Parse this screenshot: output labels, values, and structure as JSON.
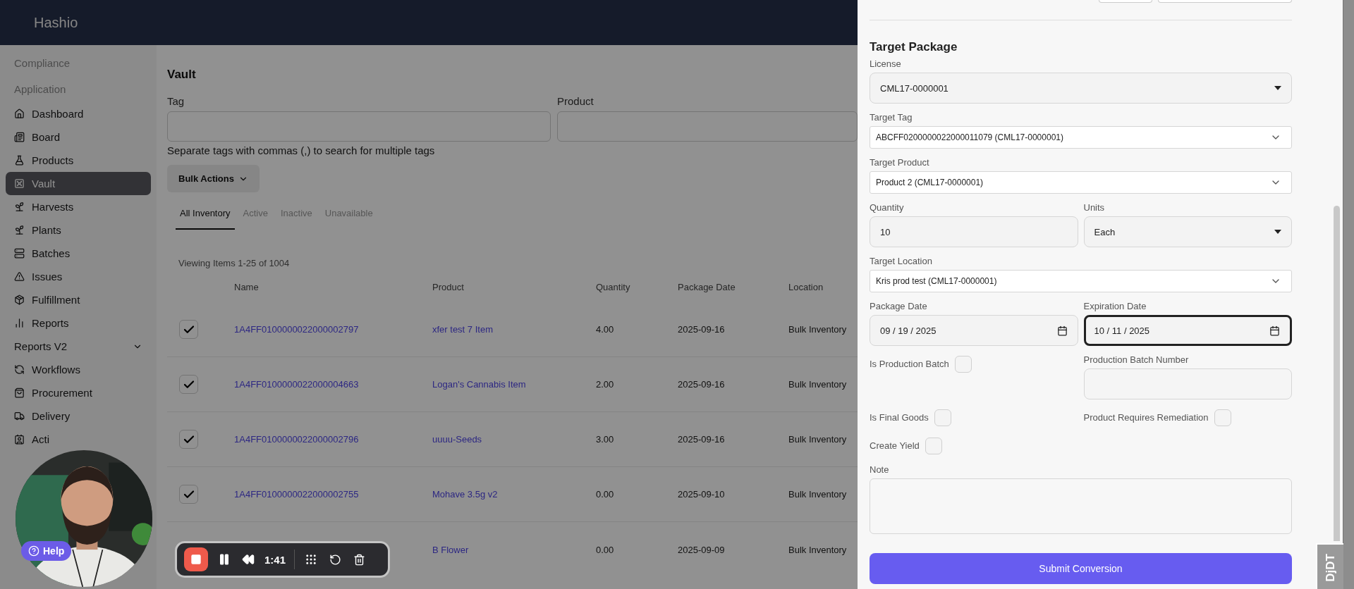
{
  "header": {
    "brand": "Hashio"
  },
  "sidebar": {
    "sections": [
      "Compliance",
      "Application"
    ],
    "items": [
      {
        "label": "Dashboard",
        "kind": "link",
        "selected": false
      },
      {
        "label": "Board",
        "kind": "link",
        "selected": false
      },
      {
        "label": "Products",
        "kind": "link",
        "selected": false
      },
      {
        "label": "Vault",
        "kind": "link",
        "selected": true
      },
      {
        "label": "Harvests",
        "kind": "link",
        "selected": false
      },
      {
        "label": "Plants",
        "kind": "link",
        "selected": false
      },
      {
        "label": "Batches",
        "kind": "link",
        "selected": false
      },
      {
        "label": "Issues",
        "kind": "link",
        "selected": false
      },
      {
        "label": "Fulfillment",
        "kind": "link",
        "selected": false
      },
      {
        "label": "Reports",
        "kind": "link",
        "selected": false
      },
      {
        "label": "Reports V2",
        "kind": "group",
        "expanded": false
      },
      {
        "label": "Workflows",
        "kind": "link",
        "selected": false
      },
      {
        "label": "Procurement",
        "kind": "link",
        "selected": false
      },
      {
        "label": "Delivery",
        "kind": "link",
        "selected": false
      },
      {
        "label": "Acti",
        "kind": "link",
        "selected": false
      }
    ]
  },
  "main": {
    "title": "Vault",
    "filters": [
      {
        "label": "Tag"
      },
      {
        "label": "Product"
      }
    ],
    "filter_hint": "Separate tags with commas (,) to search for multiple tags",
    "bulk_actions": "Bulk Actions",
    "tabs": [
      {
        "label": "All Inventory",
        "selected": true
      },
      {
        "label": "Active",
        "selected": false
      },
      {
        "label": "Inactive",
        "selected": false
      },
      {
        "label": "Unavailable",
        "selected": false
      }
    ],
    "viewing": "Viewing Items 1-25 of 1004",
    "table": {
      "columns": [
        "Name",
        "Product",
        "Quantity",
        "Package Date",
        "Location"
      ],
      "rows": [
        {
          "checked": true,
          "name": "1A4FF0100000022000002797",
          "product": "xfer test 7 Item",
          "quantity": "4.00",
          "package_date": "2025-09-16",
          "location": "Bulk Inventory"
        },
        {
          "checked": true,
          "name": "1A4FF0100000022000004663",
          "product": "Logan's Cannabis Item",
          "quantity": "2.00",
          "package_date": "2025-09-16",
          "location": "Bulk Inventory"
        },
        {
          "checked": true,
          "name": "1A4FF0100000022000002796",
          "product": "uuuu-Seeds",
          "quantity": "3.00",
          "package_date": "2025-09-16",
          "location": "Bulk Inventory"
        },
        {
          "checked": true,
          "name": "1A4FF0100000022000002755",
          "product": "Mohave 3.5g v2",
          "quantity": "0.00",
          "package_date": "2025-09-10",
          "location": "Bulk Inventory"
        },
        {
          "product": "B Flower",
          "quantity": "0.00",
          "package_date": "2025-09-09",
          "location": "Bulk Inventory"
        }
      ]
    }
  },
  "drawer": {
    "title": "Target Package",
    "rows": [
      [
        {
          "kind": "select",
          "label": "License",
          "value": "CML17-0000001"
        }
      ],
      [
        {
          "kind": "combo",
          "label": "Target Tag",
          "value": "ABCFF0200000022000011079 (CML17-0000001)"
        }
      ],
      [
        {
          "kind": "combo",
          "label": "Target Product",
          "value": "Product 2 (CML17-0000001)"
        }
      ],
      [
        {
          "kind": "input",
          "label": "Quantity",
          "value": "10"
        },
        {
          "kind": "select",
          "label": "Units",
          "value": "Each"
        }
      ],
      [
        {
          "kind": "combo",
          "label": "Target Location",
          "value": "Kris prod test (CML17-0000001)"
        }
      ],
      [
        {
          "kind": "date",
          "label": "Package Date",
          "value": "09 / 19 / 2025",
          "focused": false
        },
        {
          "kind": "date",
          "label": "Expiration Date",
          "value": "10 / 11 / 2025",
          "focused": true
        }
      ],
      [
        {
          "kind": "checkbox",
          "label": "Is Production Batch",
          "checked": false
        },
        {
          "kind": "input",
          "label": "Production Batch Number"
        }
      ],
      [
        {
          "kind": "checkbox",
          "label": "Is Final Goods",
          "checked": false
        },
        {
          "kind": "checkbox",
          "label": "Product Requires Remediation",
          "checked": false
        }
      ],
      [
        {
          "kind": "checkbox",
          "label": "Create Yield",
          "checked": false
        }
      ],
      [
        {
          "kind": "textarea",
          "label": "Note"
        }
      ]
    ],
    "submit": "Submit Conversion"
  },
  "debug_toolbar": {
    "label": "DjDT"
  },
  "help": {
    "label": "Help"
  },
  "recorder": {
    "time": "1:41"
  }
}
